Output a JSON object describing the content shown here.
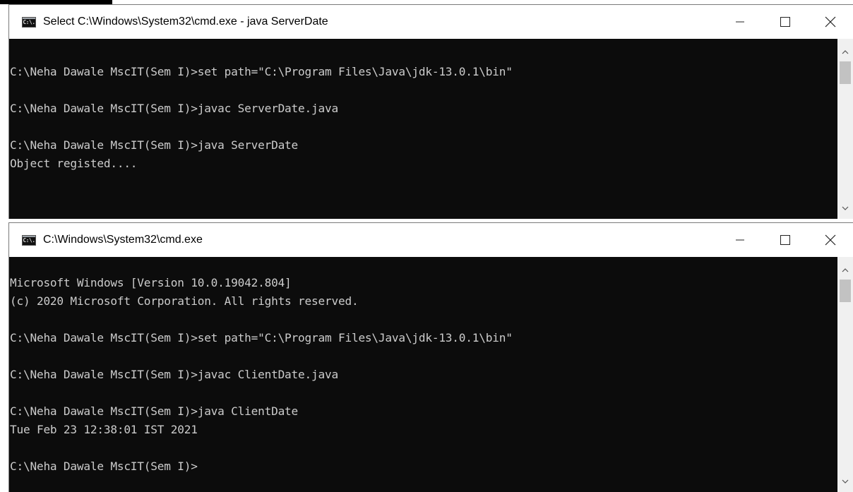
{
  "windows": [
    {
      "title": "Select C:\\Windows\\System32\\cmd.exe - java  ServerDate",
      "icon_label": "C:\\.",
      "lines": [
        "C:\\Neha Dawale MscIT(Sem I)>set path=\"C:\\Program Files\\Java\\jdk-13.0.1\\bin\"",
        "",
        "C:\\Neha Dawale MscIT(Sem I)>javac ServerDate.java",
        "",
        "C:\\Neha Dawale MscIT(Sem I)>java ServerDate",
        "Object registed...."
      ]
    },
    {
      "title": "C:\\Windows\\System32\\cmd.exe",
      "icon_label": "C:\\.",
      "lines": [
        "Microsoft Windows [Version 10.0.19042.804]",
        "(c) 2020 Microsoft Corporation. All rights reserved.",
        "",
        "C:\\Neha Dawale MscIT(Sem I)>set path=\"C:\\Program Files\\Java\\jdk-13.0.1\\bin\"",
        "",
        "C:\\Neha Dawale MscIT(Sem I)>javac ClientDate.java",
        "",
        "C:\\Neha Dawale MscIT(Sem I)>java ClientDate",
        "Tue Feb 23 12:38:01 IST 2021",
        "",
        "C:\\Neha Dawale MscIT(Sem I)>"
      ]
    }
  ],
  "icons": {
    "minimize": "minimize-icon",
    "maximize": "maximize-icon",
    "close": "close-icon",
    "scroll_up": "chevron-up-icon",
    "scroll_down": "chevron-down-icon"
  },
  "colors": {
    "console_bg": "#0c0c0c",
    "console_text": "#cccccc",
    "titlebar_bg": "#ffffff"
  }
}
